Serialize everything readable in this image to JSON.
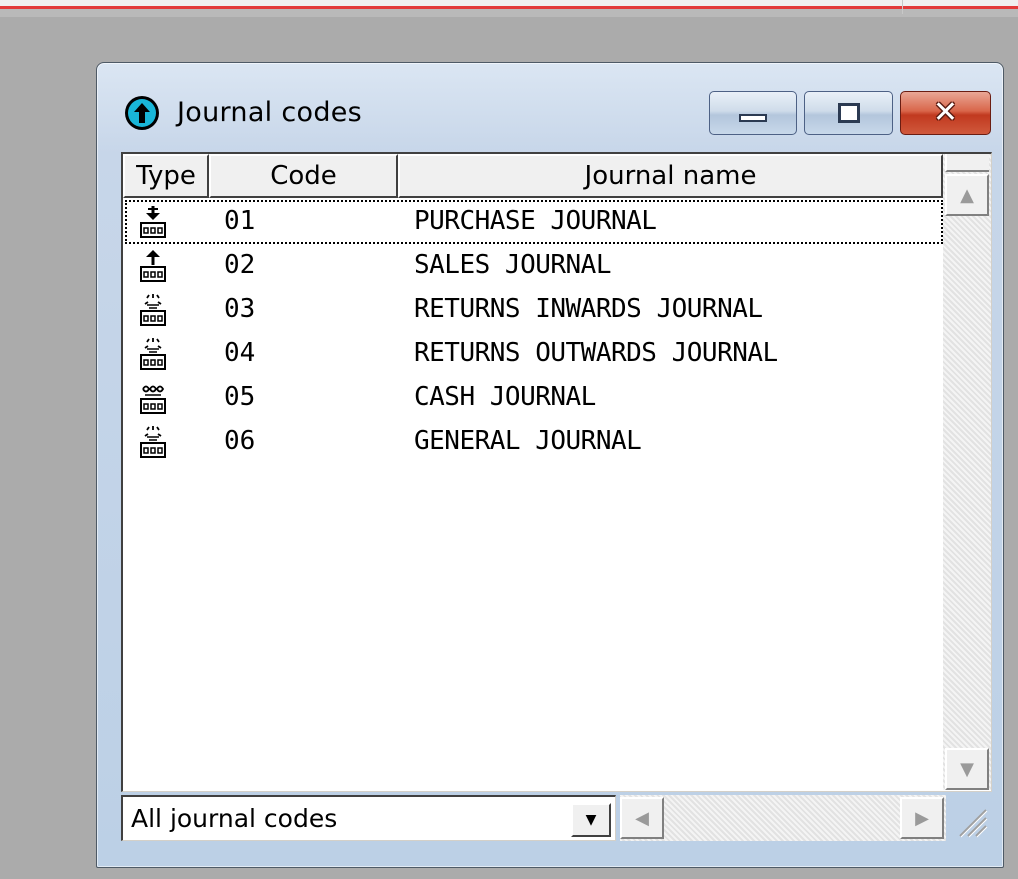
{
  "window": {
    "title": "Journal codes",
    "controls": {
      "minimize": "minimize-icon",
      "maximize": "restore-icon",
      "close": "close-icon"
    }
  },
  "list": {
    "columns": [
      "Type",
      "Code",
      "Journal name"
    ],
    "rows": [
      {
        "type_icon": "purchase-journal-icon",
        "code": "01",
        "name": "PURCHASE JOURNAL"
      },
      {
        "type_icon": "sales-journal-icon",
        "code": "02",
        "name": "SALES JOURNAL"
      },
      {
        "type_icon": "returns-journal-icon",
        "code": "03",
        "name": "RETURNS INWARDS JOURNAL"
      },
      {
        "type_icon": "returns-journal-icon",
        "code": "04",
        "name": "RETURNS OUTWARDS JOURNAL"
      },
      {
        "type_icon": "cash-journal-icon",
        "code": "05",
        "name": "CASH JOURNAL"
      },
      {
        "type_icon": "general-journal-icon",
        "code": "06",
        "name": "GENERAL JOURNAL"
      }
    ],
    "focused_row": 0
  },
  "filter": {
    "value": "All journal codes"
  },
  "colors": {
    "title_icon": "#19b6d8",
    "close_button": "#c1391f",
    "parent_accent": "#e23a3a"
  }
}
